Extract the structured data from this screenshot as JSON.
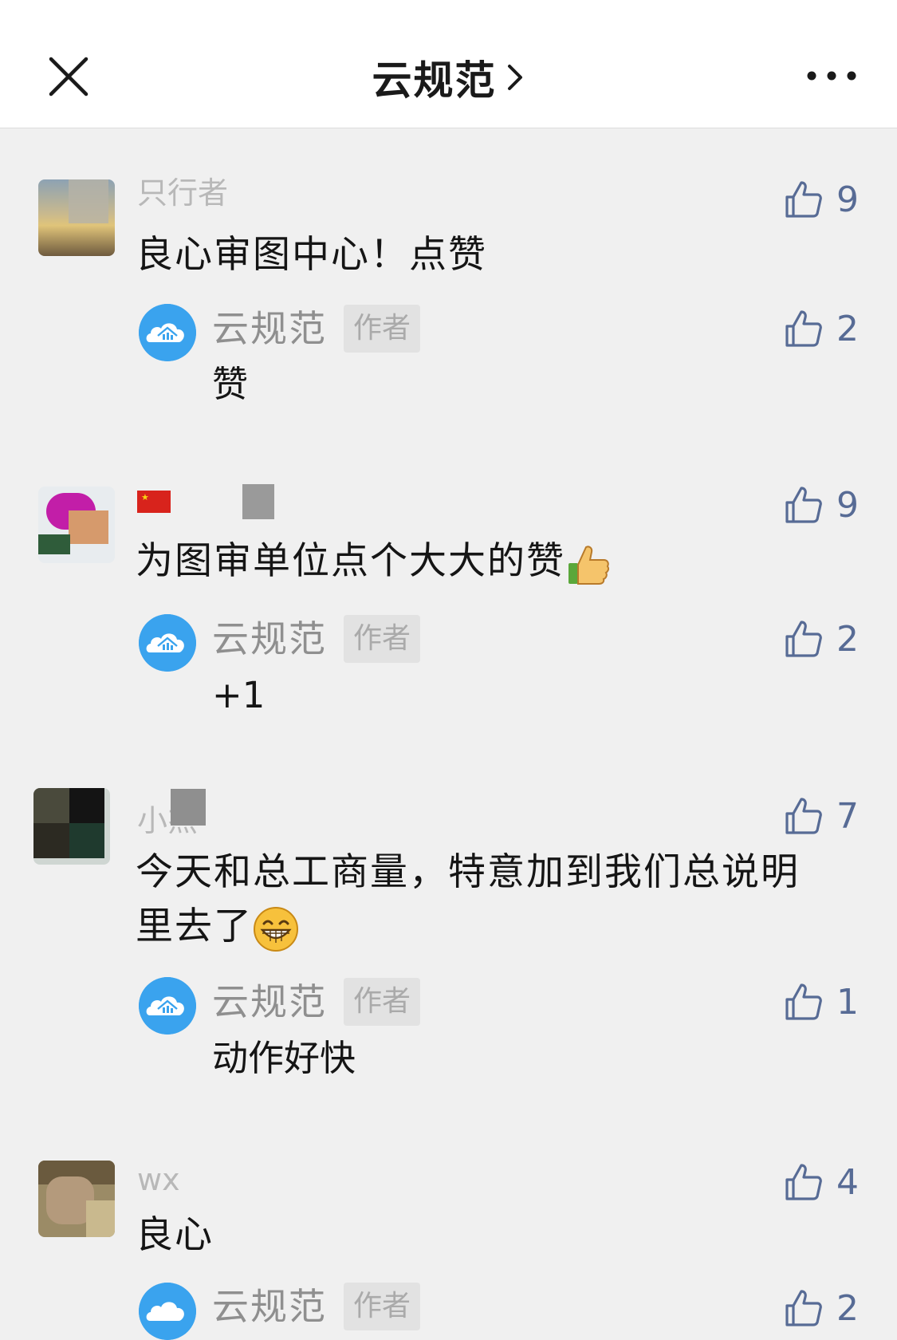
{
  "header": {
    "title": "云规范",
    "close_icon": "close-icon",
    "chevron_icon": "chevron-right-icon",
    "more_icon": "more-horizontal-icon"
  },
  "colors": {
    "like_accent": "#576b95",
    "author_tag_bg": "#e2e2e2",
    "page_bg": "#f0f0f0",
    "header_bg": "#ffffff"
  },
  "comments": [
    {
      "nickname": "只行者",
      "text": "良心审图中心！点赞",
      "likes": "9",
      "reply": {
        "name": "云规范",
        "tag": "作者",
        "text": "赞",
        "likes": "2"
      }
    },
    {
      "nickname": "",
      "text": "为图审单位点个大大的赞",
      "emoji": "thumbs-up-emoji",
      "likes": "9",
      "reply": {
        "name": "云规范",
        "tag": "作者",
        "text": "+1",
        "likes": "2"
      }
    },
    {
      "nickname": "小杰",
      "text_line1": "今天和总工商量，特意加到我们总说明",
      "text_line2": "里去了",
      "emoji": "grin-emoji",
      "likes": "7",
      "reply": {
        "name": "云规范",
        "tag": "作者",
        "text": "动作好快",
        "likes": "1"
      }
    },
    {
      "nickname": "wx",
      "text": "良心",
      "likes": "4",
      "reply": {
        "name": "云规范",
        "tag": "作者",
        "text": "",
        "likes": "2"
      }
    }
  ]
}
